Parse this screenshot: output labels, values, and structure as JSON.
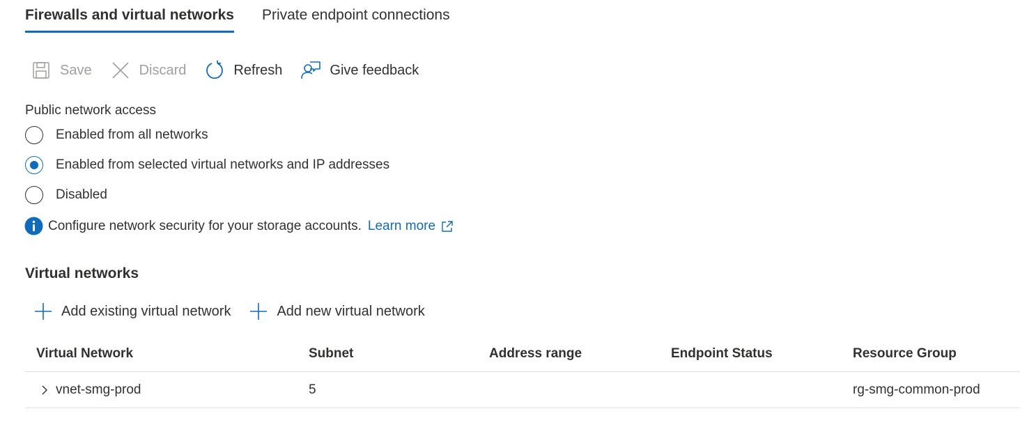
{
  "tabs": [
    {
      "label": "Firewalls and virtual networks",
      "active": true
    },
    {
      "label": "Private endpoint connections",
      "active": false
    }
  ],
  "toolbar": {
    "save": {
      "label": "Save",
      "icon": "save-icon",
      "enabled": false
    },
    "discard": {
      "label": "Discard",
      "icon": "close-icon",
      "enabled": false
    },
    "refresh": {
      "label": "Refresh",
      "icon": "refresh-icon",
      "enabled": true
    },
    "feedback": {
      "label": "Give feedback",
      "icon": "feedback-icon",
      "enabled": true
    }
  },
  "public_network_access": {
    "label": "Public network access",
    "options": [
      {
        "label": "Enabled from all networks",
        "selected": false
      },
      {
        "label": "Enabled from selected virtual networks and IP addresses",
        "selected": true
      },
      {
        "label": "Disabled",
        "selected": false
      }
    ]
  },
  "info": {
    "icon": "info-icon",
    "text": "Configure network security for your storage accounts.",
    "link_text": "Learn more"
  },
  "virtual_networks": {
    "title": "Virtual networks",
    "add_existing_label": "Add existing virtual network",
    "add_new_label": "Add new virtual network",
    "columns": [
      "Virtual Network",
      "Subnet",
      "Address range",
      "Endpoint Status",
      "Resource Group"
    ],
    "rows": [
      {
        "virtual_network": "vnet-smg-prod",
        "subnet": "5",
        "address_range": "",
        "endpoint_status": "",
        "resource_group": "rg-smg-common-prod"
      }
    ]
  },
  "colors": {
    "accent": "#0f6cbd",
    "text": "#323130",
    "disabled": "#a19f9d",
    "divider": "#e1dfdd"
  }
}
